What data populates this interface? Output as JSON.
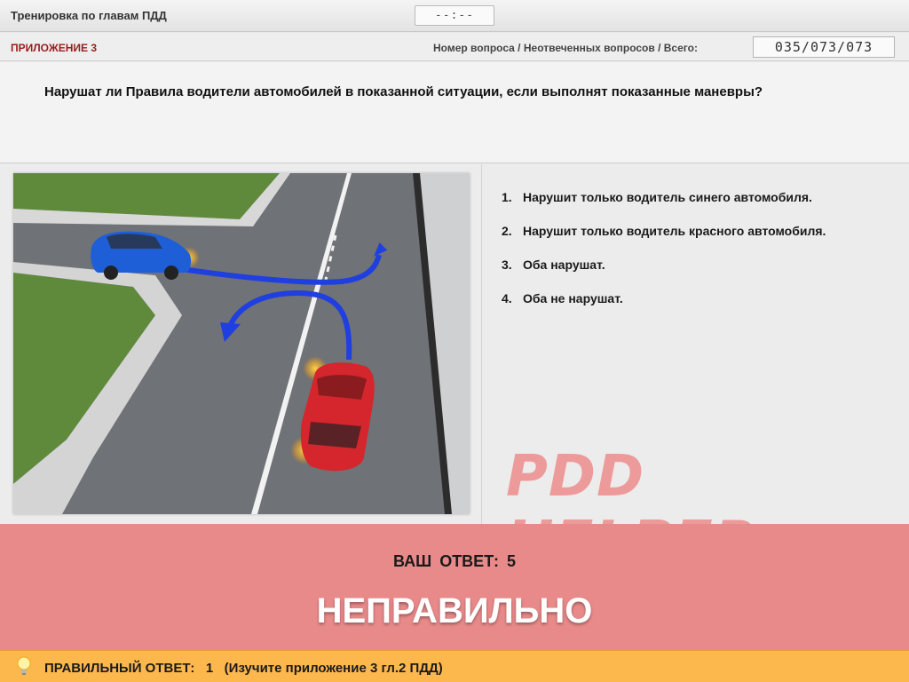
{
  "header": {
    "title": "Тренировка по главам ПДД",
    "timer": "--:--"
  },
  "subheader": {
    "appendix": "ПРИЛОЖЕНИЕ 3",
    "counter_label": "Номер вопроса / Неотвеченных вопросов / Всего:",
    "counter_value": "035/073/073"
  },
  "question": {
    "text": "Нарушат ли Правила водители автомобилей в показанной ситуации, если выполнят показанные маневры?"
  },
  "answers": [
    {
      "num": "1.",
      "text": "Нарушит только водитель синего автомобиля."
    },
    {
      "num": "2.",
      "text": "Нарушит только водитель красного автомобиля."
    },
    {
      "num": "3.",
      "text": "Оба нарушат."
    },
    {
      "num": "4.",
      "text": "Оба не нарушат."
    }
  ],
  "watermark": "PDD HELPER",
  "result": {
    "your_answer_label": "ВАШ  ОТВЕТ:",
    "your_answer_value": "5",
    "verdict": "НЕПРАВИЛЬНО"
  },
  "hint": {
    "text": "ПРАВИЛЬНЫЙ ОТВЕТ:   1   (Изучите приложение 3 гл.2 ПДД)"
  },
  "colors": {
    "result_bg": "#e98a8a",
    "hint_bg": "#fdb84d",
    "appendix_text": "#9b1c1c",
    "arrow": "#1f3fe0",
    "blue_car": "#1e5fd8",
    "red_car": "#d4262c"
  }
}
